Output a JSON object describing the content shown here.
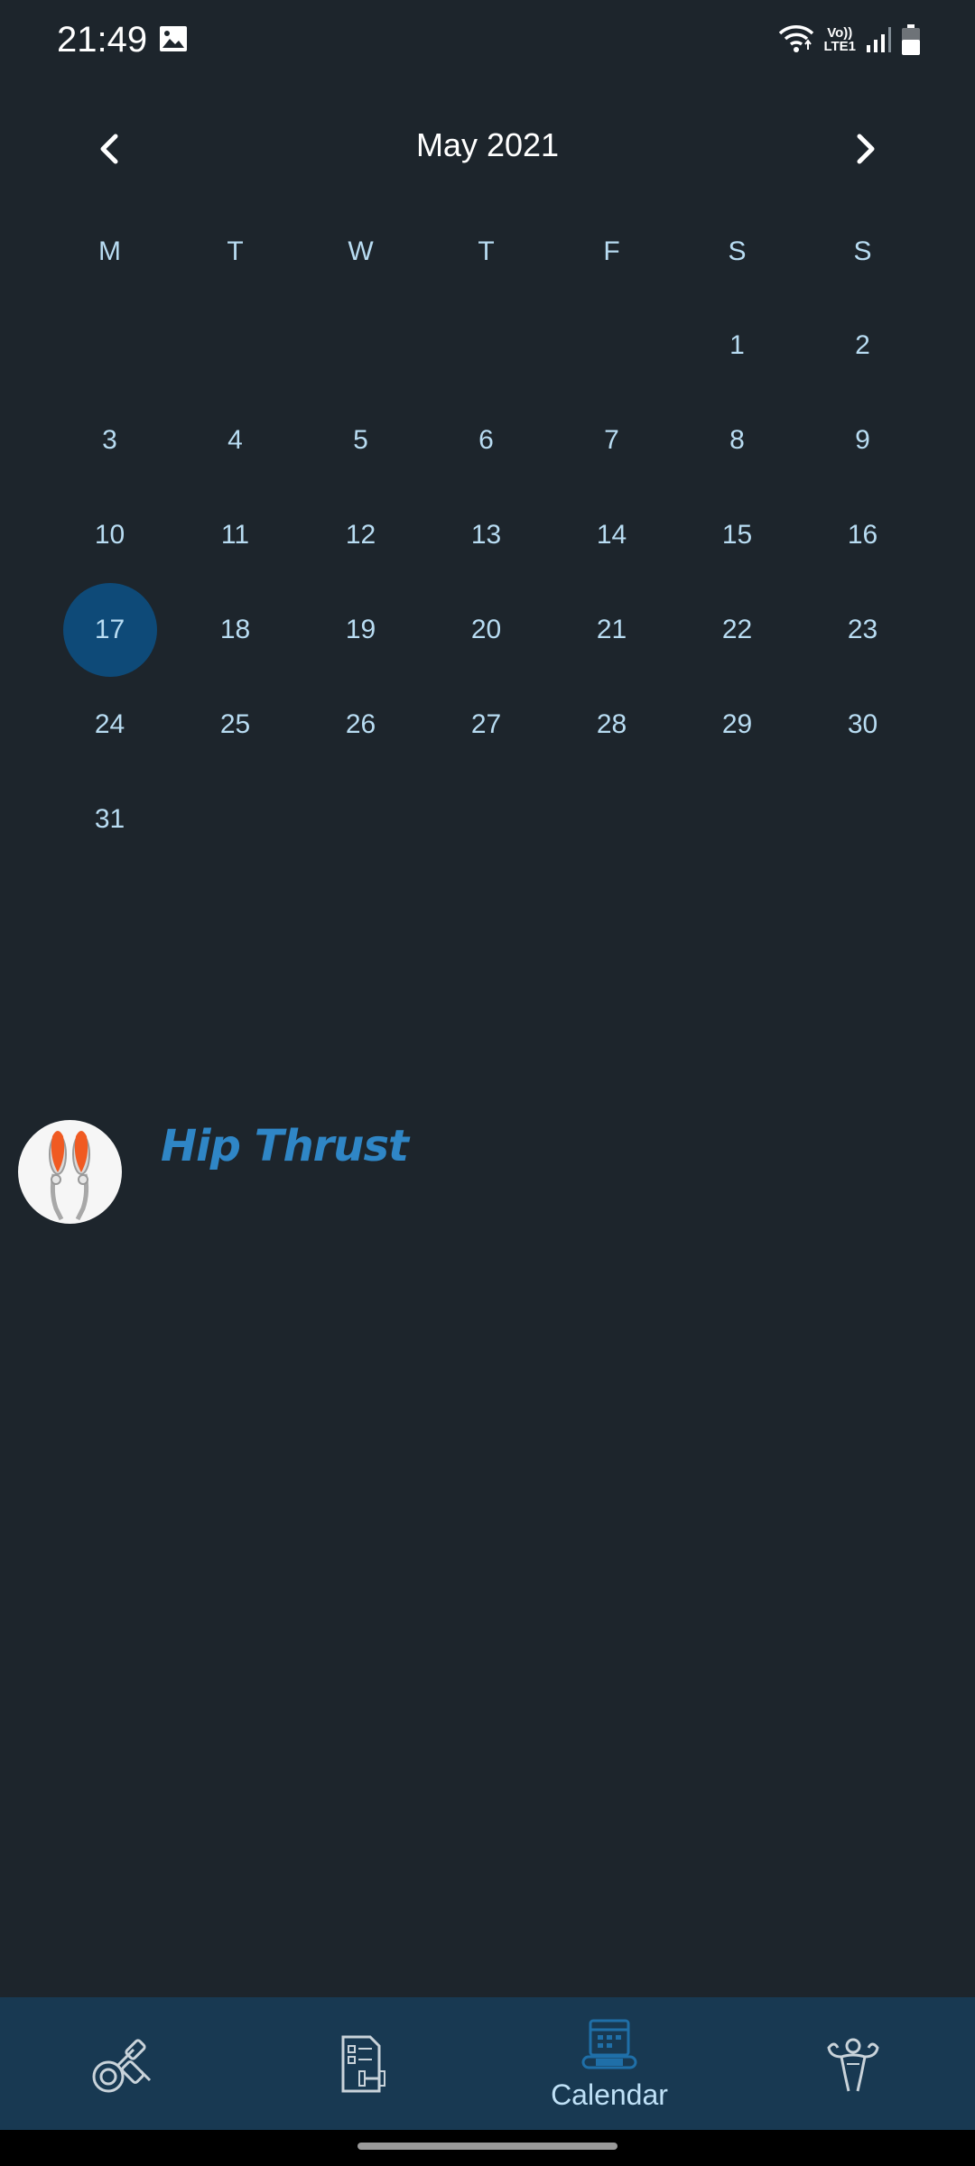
{
  "status_bar": {
    "time": "21:49",
    "network_top": "Vo))",
    "network_bottom": "LTE1",
    "icons": [
      "gallery-icon",
      "wifi-icon",
      "signal-icon",
      "battery-icon"
    ]
  },
  "calendar": {
    "month_title": "May 2021",
    "prev_icon": "chevron-left-icon",
    "next_icon": "chevron-right-icon",
    "weekdays": [
      "M",
      "T",
      "W",
      "T",
      "F",
      "S",
      "S"
    ],
    "days": [
      "",
      "",
      "",
      "",
      "",
      "1",
      "2",
      "3",
      "4",
      "5",
      "6",
      "7",
      "8",
      "9",
      "10",
      "11",
      "12",
      "13",
      "14",
      "15",
      "16",
      "17",
      "18",
      "19",
      "20",
      "21",
      "22",
      "23",
      "24",
      "25",
      "26",
      "27",
      "28",
      "29",
      "30",
      "31",
      "",
      "",
      "",
      "",
      "",
      ""
    ],
    "selected_day": "17",
    "selected_color": "#0e4a78"
  },
  "workouts": [
    {
      "title": "Hip Thrust",
      "icon": "glutes-muscle-icon"
    }
  ],
  "bottom_nav": {
    "items": [
      {
        "icon": "dumbbell-icon",
        "label": ""
      },
      {
        "icon": "workout-plan-icon",
        "label": ""
      },
      {
        "icon": "calendar-icon",
        "label": "Calendar",
        "active": true
      },
      {
        "icon": "muscle-man-icon",
        "label": ""
      }
    ]
  },
  "colors": {
    "background": "#1d252c",
    "day_text": "#b8dcf2",
    "accent": "#2f86c6",
    "nav_background": "#183952"
  }
}
